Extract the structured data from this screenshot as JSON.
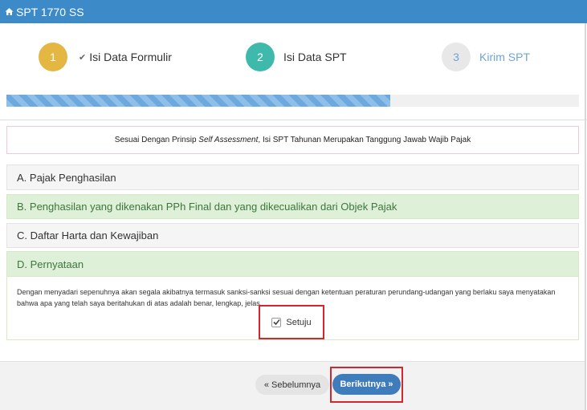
{
  "header": {
    "title": "SPT 1770 SS",
    "icon": "home-icon"
  },
  "steps": [
    {
      "number": "1",
      "label": "Isi Data Formulir",
      "status": "done",
      "color": "#e3b742"
    },
    {
      "number": "2",
      "label": "Isi Data SPT",
      "status": "active",
      "color": "#3fb9ab"
    },
    {
      "number": "3",
      "label": "Kirim SPT",
      "status": "pending",
      "color": "#e8e8e8"
    }
  ],
  "progress": {
    "value": 0.67
  },
  "notice": {
    "prefix": "Sesuai Dengan Prinsip ",
    "emphasis": "Self Assessment",
    "suffix": ", Isi SPT Tahunan Merupakan Tanggung Jawab Wajib Pajak"
  },
  "sections": {
    "a": "A. Pajak Penghasilan",
    "b": "B. Penghasilan yang dikenakan PPh Final dan yang dikecualikan dari Objek Pajak",
    "c": "C. Daftar Harta dan Kewajiban",
    "d": "D. Pernyataan"
  },
  "statement": {
    "text": "Dengan menyadari sepenuhnya akan segala akibatnya termasuk sanksi-sanksi sesuai dengan ketentuan peraturan perundang-udangan yang berlaku saya menyatakan bahwa apa yang telah saya beritahukan di atas adalah benar, lengkap, jelas.",
    "checkbox_label": "Setuju",
    "checked": true
  },
  "footer": {
    "prev_label": "« Sebelumnya",
    "next_label": "Berikutnya »"
  },
  "colors": {
    "header": "#3d8ac8",
    "highlight": "#d0282e",
    "next_button": "#3f7cbc"
  }
}
